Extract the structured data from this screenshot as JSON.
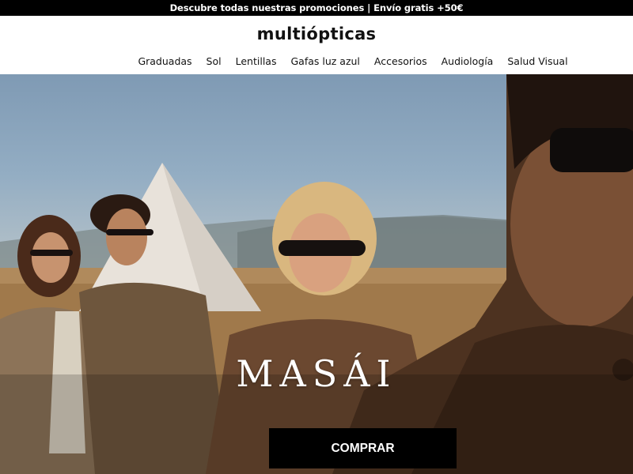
{
  "promo": {
    "text": "Descubre todas nuestras promociones | Envío gratis +50€"
  },
  "header": {
    "logo": "multiópticas",
    "nav": [
      "Graduadas",
      "Sol",
      "Lentillas",
      "Gafas luz azul",
      "Accesorios",
      "Audiología",
      "Salud Visual"
    ]
  },
  "hero": {
    "title": "MASÁI",
    "cta_label": "COMPRAR",
    "image": "campaign-photo-models-wearing-sunglasses"
  },
  "colors": {
    "promo_bg": "#000000",
    "header_bg": "#ffffff",
    "cta_bg": "#000000",
    "cta_text": "#ffffff"
  }
}
